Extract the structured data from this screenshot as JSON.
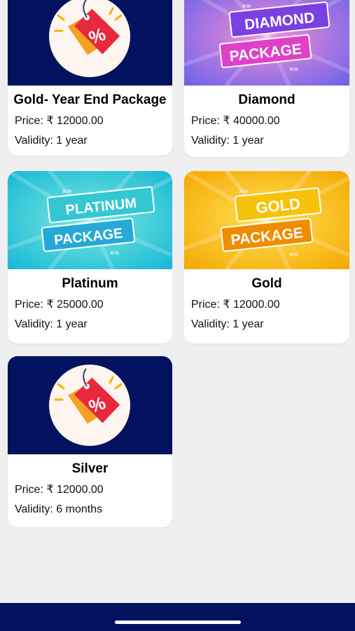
{
  "packages": [
    {
      "name": "Gold- Year End Package",
      "price_label": "Price: ₹ 12000.00",
      "validity_label": "Validity: 1 year",
      "banner": "discount-tag"
    },
    {
      "name": "Diamond",
      "price_label": "Price: ₹ 40000.00",
      "validity_label": "Validity: 1 year",
      "banner": "diamond",
      "banner_line1": "DIAMOND",
      "banner_line2": "PACKAGE"
    },
    {
      "name": "Platinum",
      "price_label": "Price: ₹ 25000.00",
      "validity_label": "Validity: 1 year",
      "banner": "platinum",
      "banner_line1": "PLATINUM",
      "banner_line2": "PACKAGE"
    },
    {
      "name": "Gold",
      "price_label": "Price: ₹ 12000.00",
      "validity_label": "Validity: 1 year",
      "banner": "gold",
      "banner_line1": "GOLD",
      "banner_line2": "PACKAGE"
    },
    {
      "name": "Silver",
      "price_label": "Price: ₹ 12000.00",
      "validity_label": "Validity: 6 months",
      "banner": "discount-tag"
    }
  ],
  "tag_symbol": "%",
  "colors": {
    "navy": "#03125e",
    "page_bg": "#efefef",
    "card_bg": "#ffffff",
    "diamond": "#9b5de5",
    "platinum": "#2fd3d3",
    "gold": "#f7b500",
    "tag_red": "#e8283c"
  }
}
